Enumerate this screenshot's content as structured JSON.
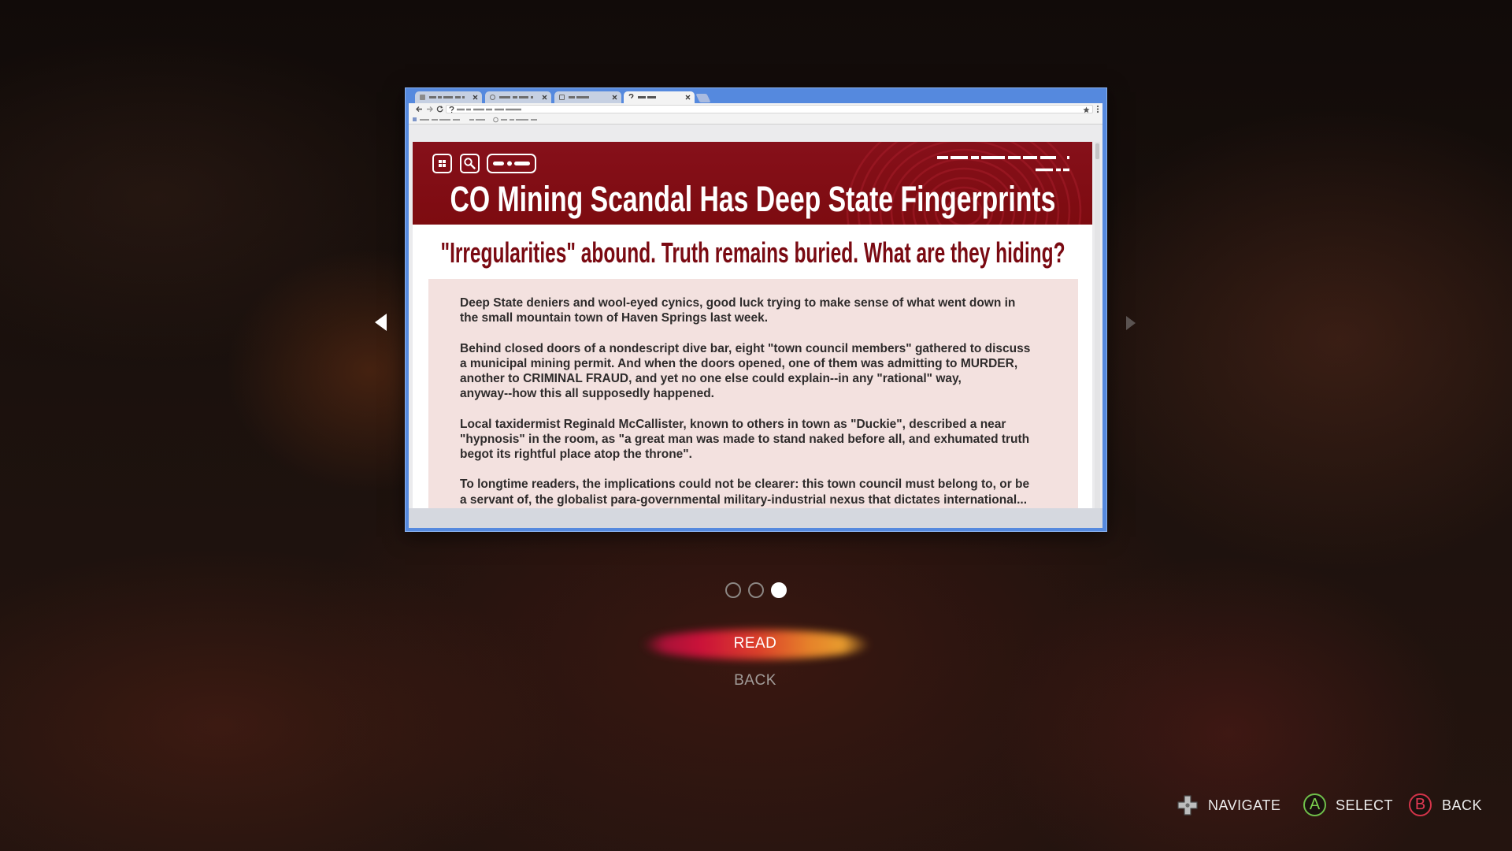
{
  "colors": {
    "frame_blue": "#5589de",
    "header_red": "#7d0b10",
    "subtitle_red": "#7a0a12",
    "article_box": "#f3e1df",
    "read_glow_start": "#d3123c",
    "read_glow_end": "#f2a330",
    "select_green": "#6fbf4a",
    "back_red": "#d33449"
  },
  "browser": {
    "tabs": [
      {
        "favicon": "page-icon",
        "active": false
      },
      {
        "favicon": "globe-icon",
        "active": false
      },
      {
        "favicon": "image-icon",
        "active": false
      },
      {
        "favicon": "help-icon",
        "active": true
      }
    ],
    "toolbar_icons": [
      "back-arrow-icon",
      "forward-arrow-icon",
      "reload-icon",
      "info-icon",
      "star-icon",
      "menu-dots-icon"
    ]
  },
  "article": {
    "header_icons": [
      "grid-icon",
      "search-icon",
      "more-options-icon"
    ],
    "title": "CO Mining Scandal Has Deep State Fingerprints",
    "subtitle": "\"Irregularities\" abound. Truth remains buried. What are they hiding?",
    "paragraphs": [
      [
        "Deep State deniers and wool-eyed cynics, good luck trying to make sense of what went down in",
        "the small mountain town of Haven Springs last week."
      ],
      [
        "Behind closed doors of a nondescript dive bar, eight \"town council members\" gathered to discuss",
        "a municipal mining permit. And when the doors opened, one of them was admitting to MURDER,",
        "another to CRIMINAL FRAUD, and yet no one else could explain--in any \"rational\" way,",
        "anyway--how this all supposedly happened."
      ],
      [
        "Local taxidermist Reginald McCallister, known to others in town as \"Duckie\", described a near",
        "\"hypnosis\" in the room, as \"a great man was made to stand naked before all, and exhumated truth",
        "begot its rightful place atop the throne\"."
      ],
      [
        "To longtime readers, the implications could not be clearer: this town council must belong to, or be",
        "a servant of, the globalist para-governmental military-industrial nexus that dictates international..."
      ]
    ]
  },
  "carousel": {
    "left_arrow": "chevron-left-icon",
    "right_arrow": "chevron-right-icon",
    "total_pages": 3,
    "current_page": 3
  },
  "menu": {
    "items": [
      {
        "label": "READ",
        "selected": true
      },
      {
        "label": "BACK",
        "selected": false
      }
    ]
  },
  "prompts": {
    "navigate": {
      "icon": "dpad-icon",
      "label": "NAVIGATE"
    },
    "select": {
      "glyph": "A",
      "label": "SELECT"
    },
    "back": {
      "glyph": "B",
      "label": "BACK"
    }
  }
}
